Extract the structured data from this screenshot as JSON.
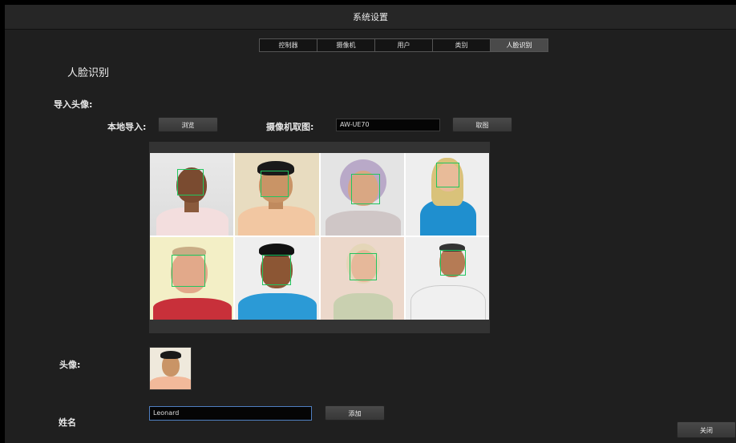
{
  "window": {
    "title": "系统设置"
  },
  "tabs": [
    {
      "label": "控制器",
      "active": false
    },
    {
      "label": "摄像机",
      "active": false
    },
    {
      "label": "用户",
      "active": false
    },
    {
      "label": "类别",
      "active": false
    },
    {
      "label": "人脸识别",
      "active": true
    }
  ],
  "face": {
    "section_title": "人脸识别",
    "import_label": "导入头像:",
    "local_import_label": "本地导入:",
    "browse_button": "浏览",
    "camera_capture_label": "摄像机取图:",
    "camera_value": "AW-UE70",
    "capture_button": "取图",
    "avatar_label": "头像:",
    "name_label": "姓名",
    "name_value": "Leonard",
    "add_button": "添加"
  },
  "footer": {
    "close_button": "关闭"
  },
  "colors": {
    "face_box": "#22c55e",
    "active_tab": "#4a4a4a",
    "focus_border": "#4f7fc0"
  }
}
